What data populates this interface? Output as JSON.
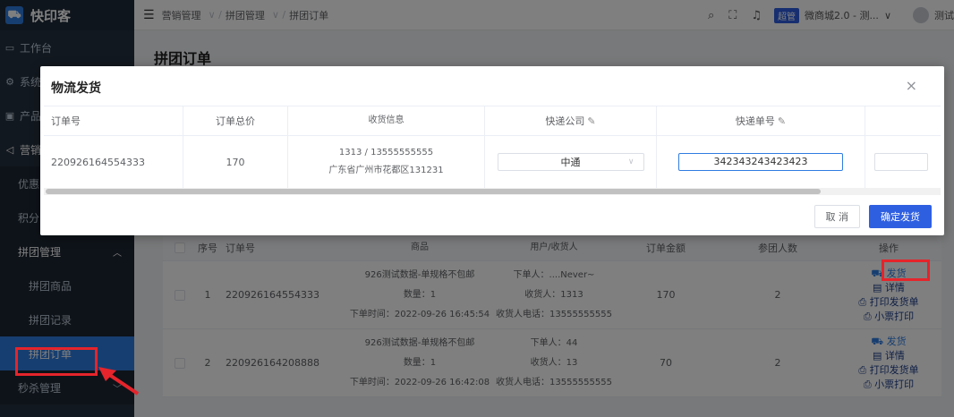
{
  "app": {
    "name": "快印客"
  },
  "sidebar": {
    "items": [
      {
        "label": "工作台",
        "icon": "monitor-icon"
      },
      {
        "label": "系统",
        "icon": "gear-icon"
      },
      {
        "label": "产品",
        "icon": "box-icon"
      },
      {
        "label": "营销",
        "icon": "megaphone-icon"
      }
    ],
    "subitems": [
      {
        "label": "优惠"
      },
      {
        "label": "积分"
      }
    ],
    "group": {
      "label": "拼团管理"
    },
    "group_items": [
      {
        "label": "拼团商品"
      },
      {
        "label": "拼团记录"
      },
      {
        "label": "拼团订单"
      }
    ],
    "next_group": {
      "label": "秒杀管理"
    }
  },
  "topbar": {
    "breadcrumb": [
      "营销管理",
      "拼团管理",
      "拼团订单"
    ],
    "role_tag": "超管",
    "shop": "微商城2.0 - 测...",
    "user": "测试"
  },
  "page": {
    "title": "拼团订单"
  },
  "orders_table": {
    "headers": [
      "序号",
      "订单号",
      "商品",
      "用户/收货人",
      "订单金额",
      "参团人数",
      "操作"
    ],
    "rows": [
      {
        "index": "1",
        "order_no": "220926164554333",
        "goods": "926测试数据-单规格不包邮",
        "qty": "数量：1",
        "time": "下单时间：2022-09-26 16:45:54",
        "buyer": "下单人：....Never~",
        "receiver": "收货人：1313",
        "phone": "收货人电话：13555555555",
        "amount": "170",
        "count": "2"
      },
      {
        "index": "2",
        "order_no": "220926164208888",
        "goods": "926测试数据-单规格不包邮",
        "qty": "数量：1",
        "time": "下单时间：2022-09-26 16:42:08",
        "buyer": "下单人：44",
        "receiver": "收货人：13",
        "phone": "收货人电话：13555555555",
        "amount": "70",
        "count": "2"
      }
    ],
    "ops": [
      "发货",
      "详情",
      "打印发货单",
      "小票打印"
    ]
  },
  "modal": {
    "title": "物流发货",
    "close": "×",
    "headers": [
      "订单号",
      "订单总价",
      "收货信息",
      "快递公司",
      "快递单号"
    ],
    "row": {
      "order_no": "220926164554333",
      "total": "170",
      "recv_line1": "1313 / 13555555555",
      "recv_line2": "广东省广州市花都区131231",
      "courier": "中通",
      "tracking_no": "342343243423423"
    },
    "cancel": "取 消",
    "confirm": "确定发货"
  },
  "colors": {
    "accent": "#2f7de1",
    "highlight": "#e5242b",
    "sidebar": "#24303f"
  }
}
